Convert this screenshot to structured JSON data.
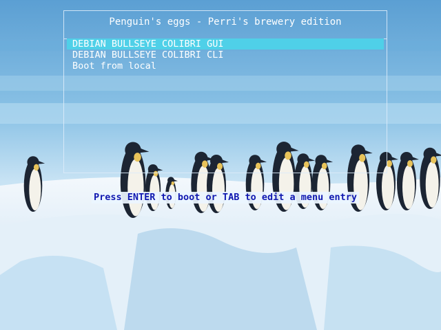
{
  "menu": {
    "title": "Penguin's eggs - Perri's brewery edition",
    "items": [
      {
        "label": "DEBIAN BULLSEYE COLIBRI GUI",
        "selected": true
      },
      {
        "label": "DEBIAN BULLSEYE COLIBRI CLI",
        "selected": false
      },
      {
        "label": "Boot from local",
        "selected": false
      }
    ]
  },
  "hint": "Press ENTER to boot or TAB to edit a menu entry",
  "background": {
    "subject": "emperor-penguins-on-snow",
    "colors": {
      "sky": "#7fb6dd",
      "sky_light": "#a9d3ee",
      "snow": "#eef6fc",
      "snow_shadow": "#8fc0e0",
      "penguin_dark": "#1c2533",
      "penguin_belly": "#f4f2ea",
      "penguin_neck": "#e8c35a",
      "highlight": "#4fd0e8",
      "hint_text": "#1018b0"
    }
  }
}
